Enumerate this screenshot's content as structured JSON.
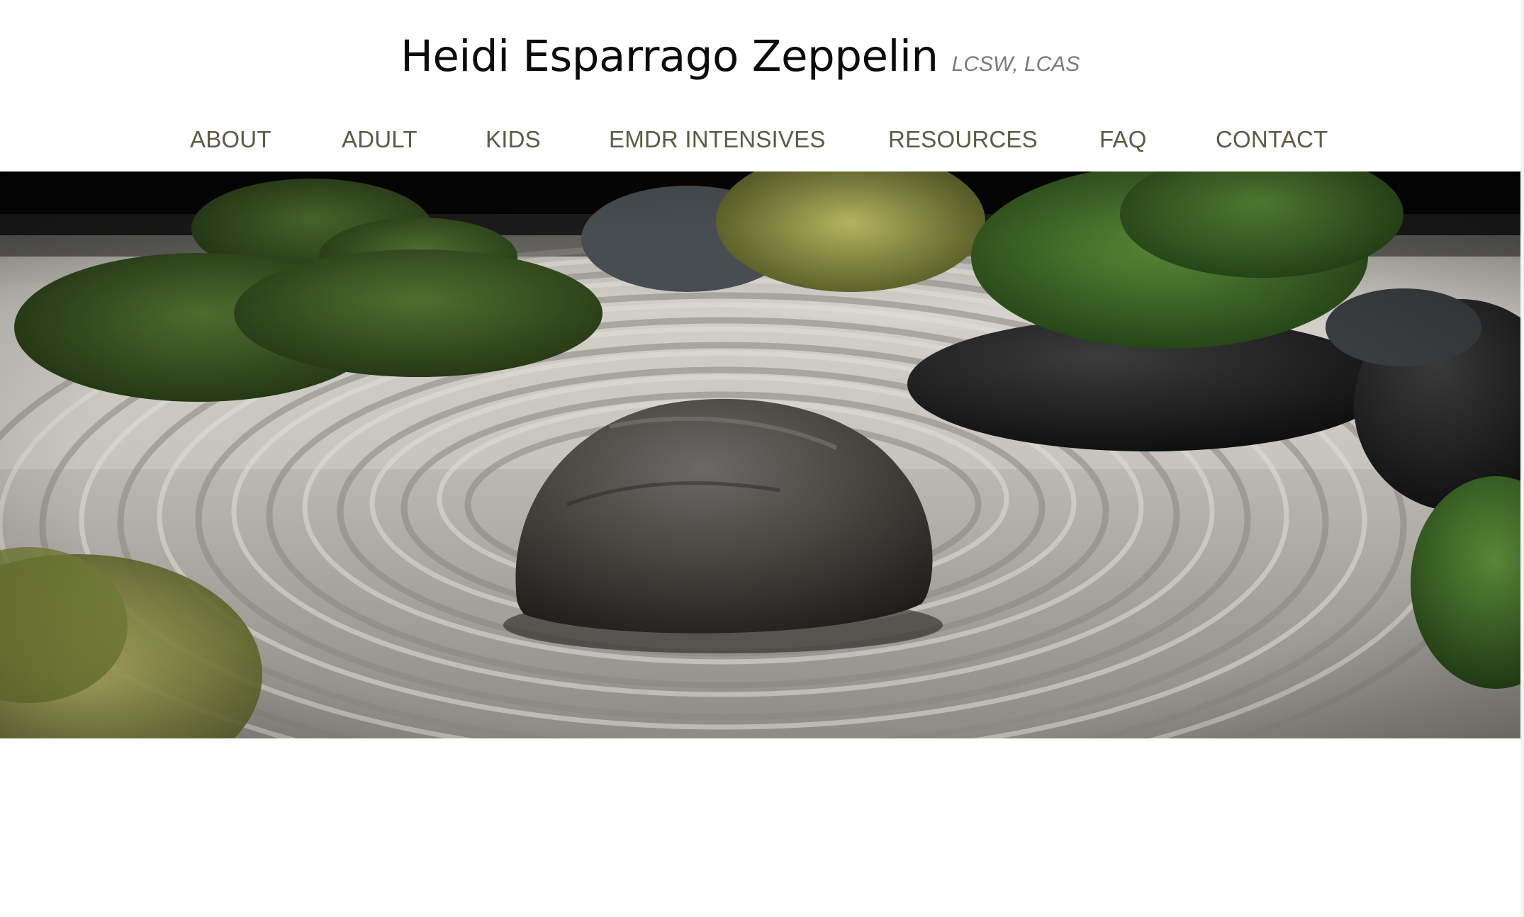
{
  "header": {
    "name": "Heidi Esparrago Zeppelin",
    "credentials": "LCSW, LCAS"
  },
  "nav": {
    "items": [
      {
        "id": "about",
        "label": "ABOUT"
      },
      {
        "id": "adult",
        "label": "ADULT"
      },
      {
        "id": "kids",
        "label": "KIDS"
      },
      {
        "id": "emdr",
        "label": "EMDR INTENSIVES"
      },
      {
        "id": "resources",
        "label": "RESOURCES"
      },
      {
        "id": "faq",
        "label": "FAQ"
      },
      {
        "id": "contact",
        "label": "CONTACT"
      }
    ]
  },
  "colors": {
    "nav_text": "#5c5b45",
    "title_text": "#0b0b0b",
    "credentials_text": "#7a7a7a"
  },
  "hero": {
    "image": "zen-garden-stone-raked-sand"
  }
}
